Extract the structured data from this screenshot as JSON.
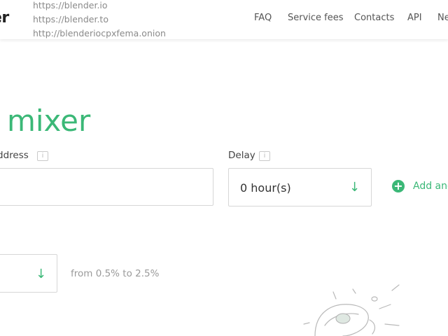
{
  "header": {
    "logo_text": "er",
    "mirrors": [
      "https://blender.io",
      "https://blender.to",
      "http://blenderiocpxfema.onion"
    ],
    "nav": {
      "faq": "FAQ",
      "service_fees": "Service fees",
      "contacts": "Contacts",
      "api": "API",
      "news": "Ne"
    }
  },
  "main": {
    "title": "n mixer",
    "address": {
      "label": "ddress",
      "info_icon": "i",
      "value": ""
    },
    "delay": {
      "label": "Delay",
      "info_icon": "i",
      "value": "0 hour(s)",
      "arrow_icon": "↓"
    },
    "add_another": {
      "icon": "+",
      "label": "Add anc"
    },
    "fee": {
      "value": "",
      "arrow_icon": "↓",
      "hint": "from 0.5% to 2.5%"
    }
  },
  "colors": {
    "accent": "#3bb877",
    "border": "#d6d6d6",
    "muted_text": "#9a9a9a"
  }
}
